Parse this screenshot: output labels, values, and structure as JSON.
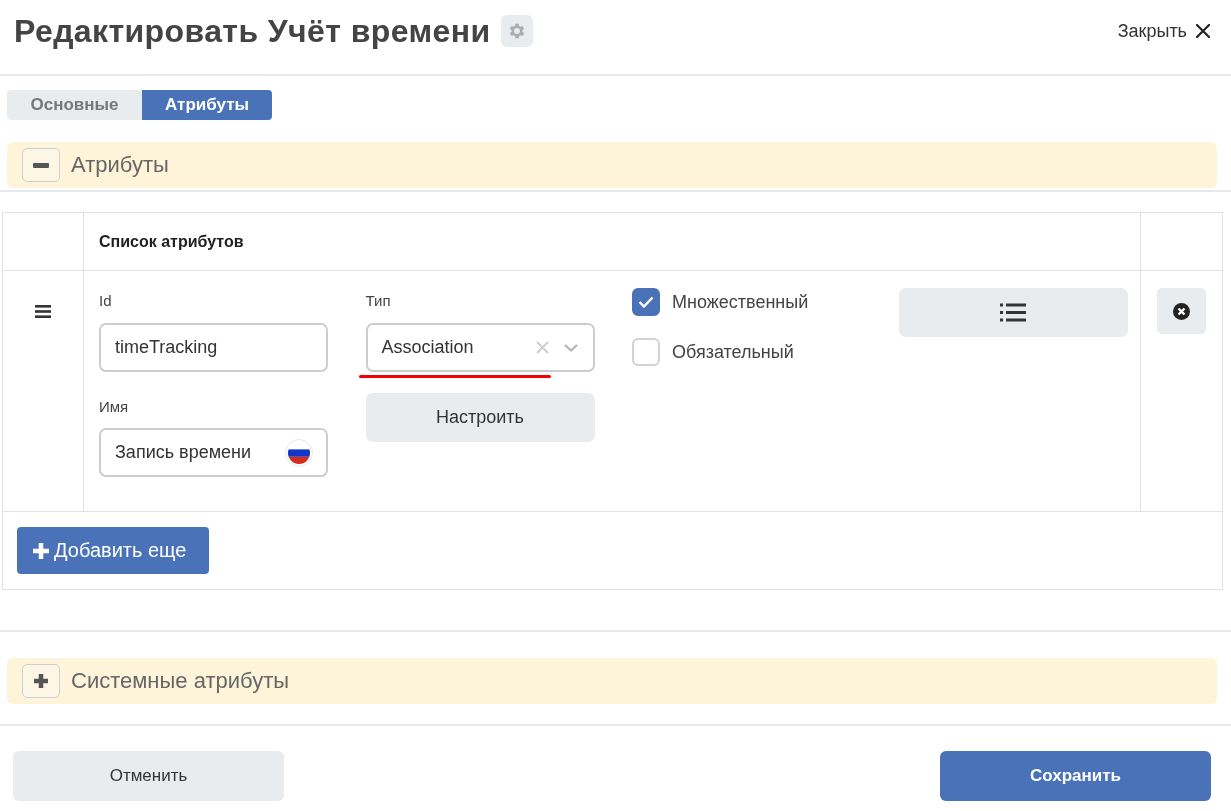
{
  "header": {
    "title": "Редактировать Учёт времени",
    "close_label": "Закрыть"
  },
  "tabs": [
    {
      "label": "Основные",
      "selected": false
    },
    {
      "label": "Атрибуты",
      "selected": true
    }
  ],
  "sections": [
    {
      "title": "Атрибуты",
      "expanded": true,
      "attribute_table": {
        "column_header": "Список атрибутов",
        "rows": [
          {
            "id_label": "Id",
            "id_value": "timeTracking",
            "type_label": "Тип",
            "type_value": "Association",
            "type_underlined": true,
            "name_label": "Имя",
            "name_value": "Запись времени",
            "configure_label": "Настроить",
            "flags": [
              {
                "label": "Множественный",
                "checked": true
              },
              {
                "label": "Обязательный",
                "checked": false
              }
            ]
          }
        ],
        "add_label": "Добавить еще"
      }
    },
    {
      "title": "Системные атрибуты",
      "expanded": false
    }
  ],
  "footer_buttons": [
    {
      "label": "Отменить",
      "kind": "secondary"
    },
    {
      "label": "Сохранить",
      "kind": "primary"
    }
  ]
}
